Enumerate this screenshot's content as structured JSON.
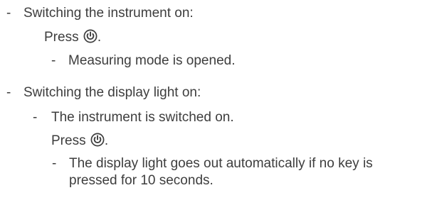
{
  "items": [
    {
      "heading": "Switching the instrument on:",
      "steps": [
        {
          "action_prefix": "Press",
          "action_suffix": ".",
          "icon": "power-key-icon"
        },
        {
          "result": "Measuring mode is opened."
        }
      ]
    },
    {
      "heading": "Switching the display light on:",
      "precondition": "The instrument is switched on.",
      "steps": [
        {
          "action_prefix": "Press",
          "action_suffix": ".",
          "icon": "power-key-icon"
        },
        {
          "result_line1": "The display light goes out automatically if no key is",
          "result_line2": "pressed for 10 seconds."
        }
      ]
    }
  ]
}
